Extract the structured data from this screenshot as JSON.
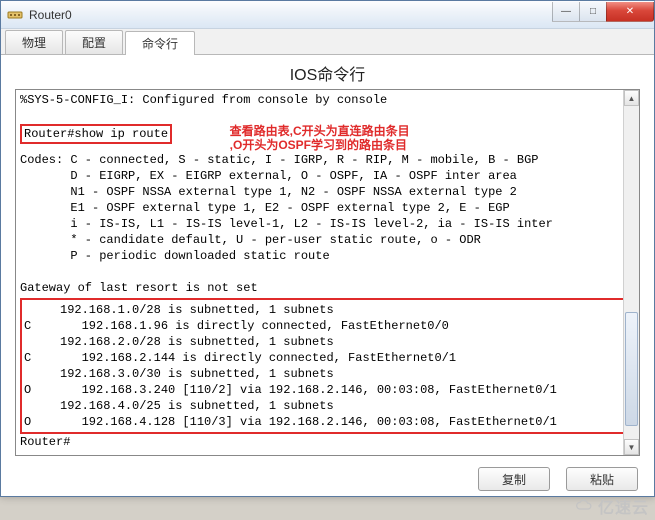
{
  "window": {
    "title": "Router0",
    "controls": {
      "min": "—",
      "max": "□",
      "close": "✕"
    }
  },
  "tabs": [
    "物理",
    "配置",
    "命令行"
  ],
  "active_tab_index": 2,
  "page_title": "IOS命令行",
  "terminal": {
    "line_config": "%SYS-5-CONFIG_I: Configured from console by console",
    "prompt1": "Router#",
    "command": "show ip route",
    "annotation_l1": "查看路由表,C开头为直连路由条目",
    "annotation_l2": ",O开头为OSPF学习到的路由条目",
    "codes": [
      "Codes: C - connected, S - static, I - IGRP, R - RIP, M - mobile, B - BGP",
      "       D - EIGRP, EX - EIGRP external, O - OSPF, IA - OSPF inter area",
      "       N1 - OSPF NSSA external type 1, N2 - OSPF NSSA external type 2",
      "       E1 - OSPF external type 1, E2 - OSPF external type 2, E - EGP",
      "       i - IS-IS, L1 - IS-IS level-1, L2 - IS-IS level-2, ia - IS-IS inter",
      "       * - candidate default, U - per-user static route, o - ODR",
      "       P - periodic downloaded static route"
    ],
    "gateway_line": "Gateway of last resort is not set",
    "routes": [
      "     192.168.1.0/28 is subnetted, 1 subnets",
      "C       192.168.1.96 is directly connected, FastEthernet0/0",
      "     192.168.2.0/28 is subnetted, 1 subnets",
      "C       192.168.2.144 is directly connected, FastEthernet0/1",
      "     192.168.3.0/30 is subnetted, 1 subnets",
      "O       192.168.3.240 [110/2] via 192.168.2.146, 00:03:08, FastEthernet0/1",
      "     192.168.4.0/25 is subnetted, 1 subnets",
      "O       192.168.4.128 [110/3] via 192.168.2.146, 00:03:08, FastEthernet0/1"
    ],
    "prompt2": "Router#"
  },
  "buttons": {
    "copy": "复制",
    "paste": "粘贴"
  },
  "watermark": "亿速云"
}
